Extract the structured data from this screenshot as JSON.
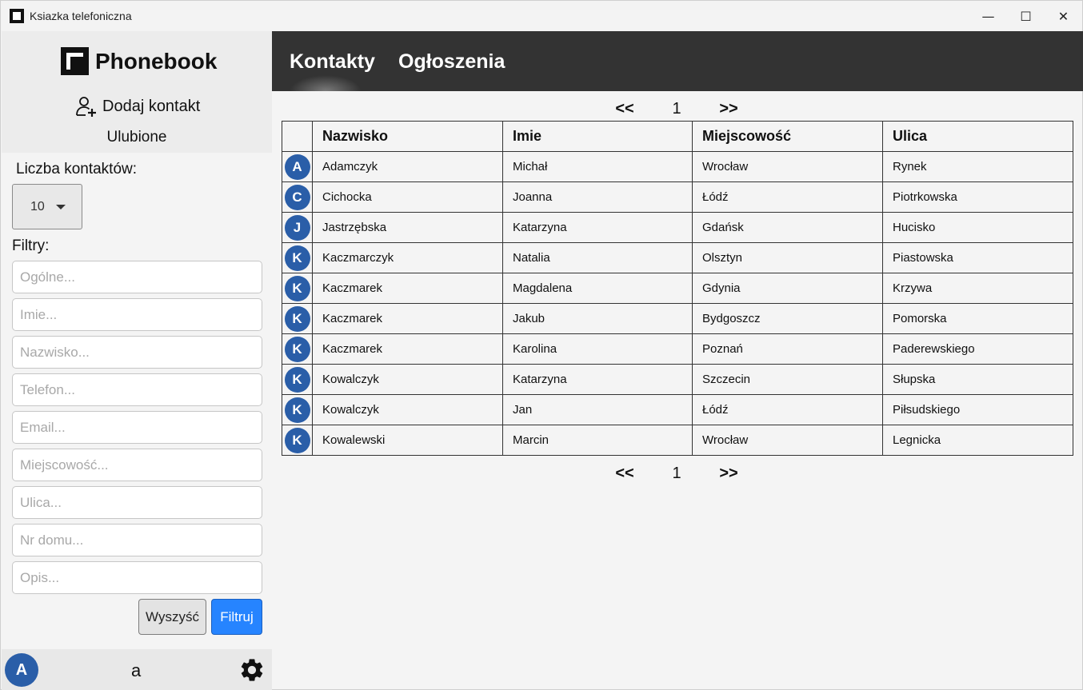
{
  "window": {
    "title": "Ksiazka telefoniczna",
    "controls": {
      "minimize": "—",
      "maximize": "☐",
      "close": "✕"
    }
  },
  "sidebar": {
    "logo_text": "Phonebook",
    "add_contact": "Dodaj kontakt",
    "favorites": "Ulubione",
    "count_label": "Liczba kontaktów:",
    "count_value": "10",
    "filters_label": "Filtry:",
    "filters": [
      {
        "placeholder": "Ogólne...",
        "value": ""
      },
      {
        "placeholder": "Imie...",
        "value": ""
      },
      {
        "placeholder": "Nazwisko...",
        "value": ""
      },
      {
        "placeholder": "Telefon...",
        "value": ""
      },
      {
        "placeholder": "Email...",
        "value": ""
      },
      {
        "placeholder": "Miejscowość...",
        "value": ""
      },
      {
        "placeholder": "Ulica...",
        "value": ""
      },
      {
        "placeholder": "Nr domu...",
        "value": ""
      },
      {
        "placeholder": "Opis...",
        "value": ""
      }
    ],
    "clear_button": "Wyszyść",
    "filter_button": "Filtruj",
    "user": {
      "avatar_letter": "A",
      "name": "a"
    }
  },
  "nav": {
    "items": [
      "Kontakty",
      "Ogłoszenia"
    ]
  },
  "pager": {
    "prev": "<<",
    "page": "1",
    "next": ">>"
  },
  "table": {
    "headers": [
      "Nazwisko",
      "Imie",
      "Miejscowość",
      "Ulica"
    ],
    "rows": [
      {
        "letter": "A",
        "nazwisko": "Adamczyk",
        "imie": "Michał",
        "miejscowosc": "Wrocław",
        "ulica": "Rynek"
      },
      {
        "letter": "C",
        "nazwisko": "Cichocka",
        "imie": "Joanna",
        "miejscowosc": "Łódź",
        "ulica": "Piotrkowska"
      },
      {
        "letter": "J",
        "nazwisko": "Jastrzębska",
        "imie": "Katarzyna",
        "miejscowosc": "Gdańsk",
        "ulica": "Hucisko"
      },
      {
        "letter": "K",
        "nazwisko": "Kaczmarczyk",
        "imie": "Natalia",
        "miejscowosc": "Olsztyn",
        "ulica": "Piastowska"
      },
      {
        "letter": "K",
        "nazwisko": "Kaczmarek",
        "imie": "Magdalena",
        "miejscowosc": "Gdynia",
        "ulica": "Krzywa"
      },
      {
        "letter": "K",
        "nazwisko": "Kaczmarek",
        "imie": "Jakub",
        "miejscowosc": "Bydgoszcz",
        "ulica": "Pomorska"
      },
      {
        "letter": "K",
        "nazwisko": "Kaczmarek",
        "imie": "Karolina",
        "miejscowosc": "Poznań",
        "ulica": "Paderewskiego"
      },
      {
        "letter": "K",
        "nazwisko": "Kowalczyk",
        "imie": "Katarzyna",
        "miejscowosc": "Szczecin",
        "ulica": "Słupska"
      },
      {
        "letter": "K",
        "nazwisko": "Kowalczyk",
        "imie": "Jan",
        "miejscowosc": "Łódź",
        "ulica": "Piłsudskiego"
      },
      {
        "letter": "K",
        "nazwisko": "Kowalewski",
        "imie": "Marcin",
        "miejscowosc": "Wrocław",
        "ulica": "Legnicka"
      }
    ]
  },
  "colors": {
    "nav_bg": "#333333",
    "avatar": "#2a5ea8",
    "primary_button": "#2684ff"
  }
}
